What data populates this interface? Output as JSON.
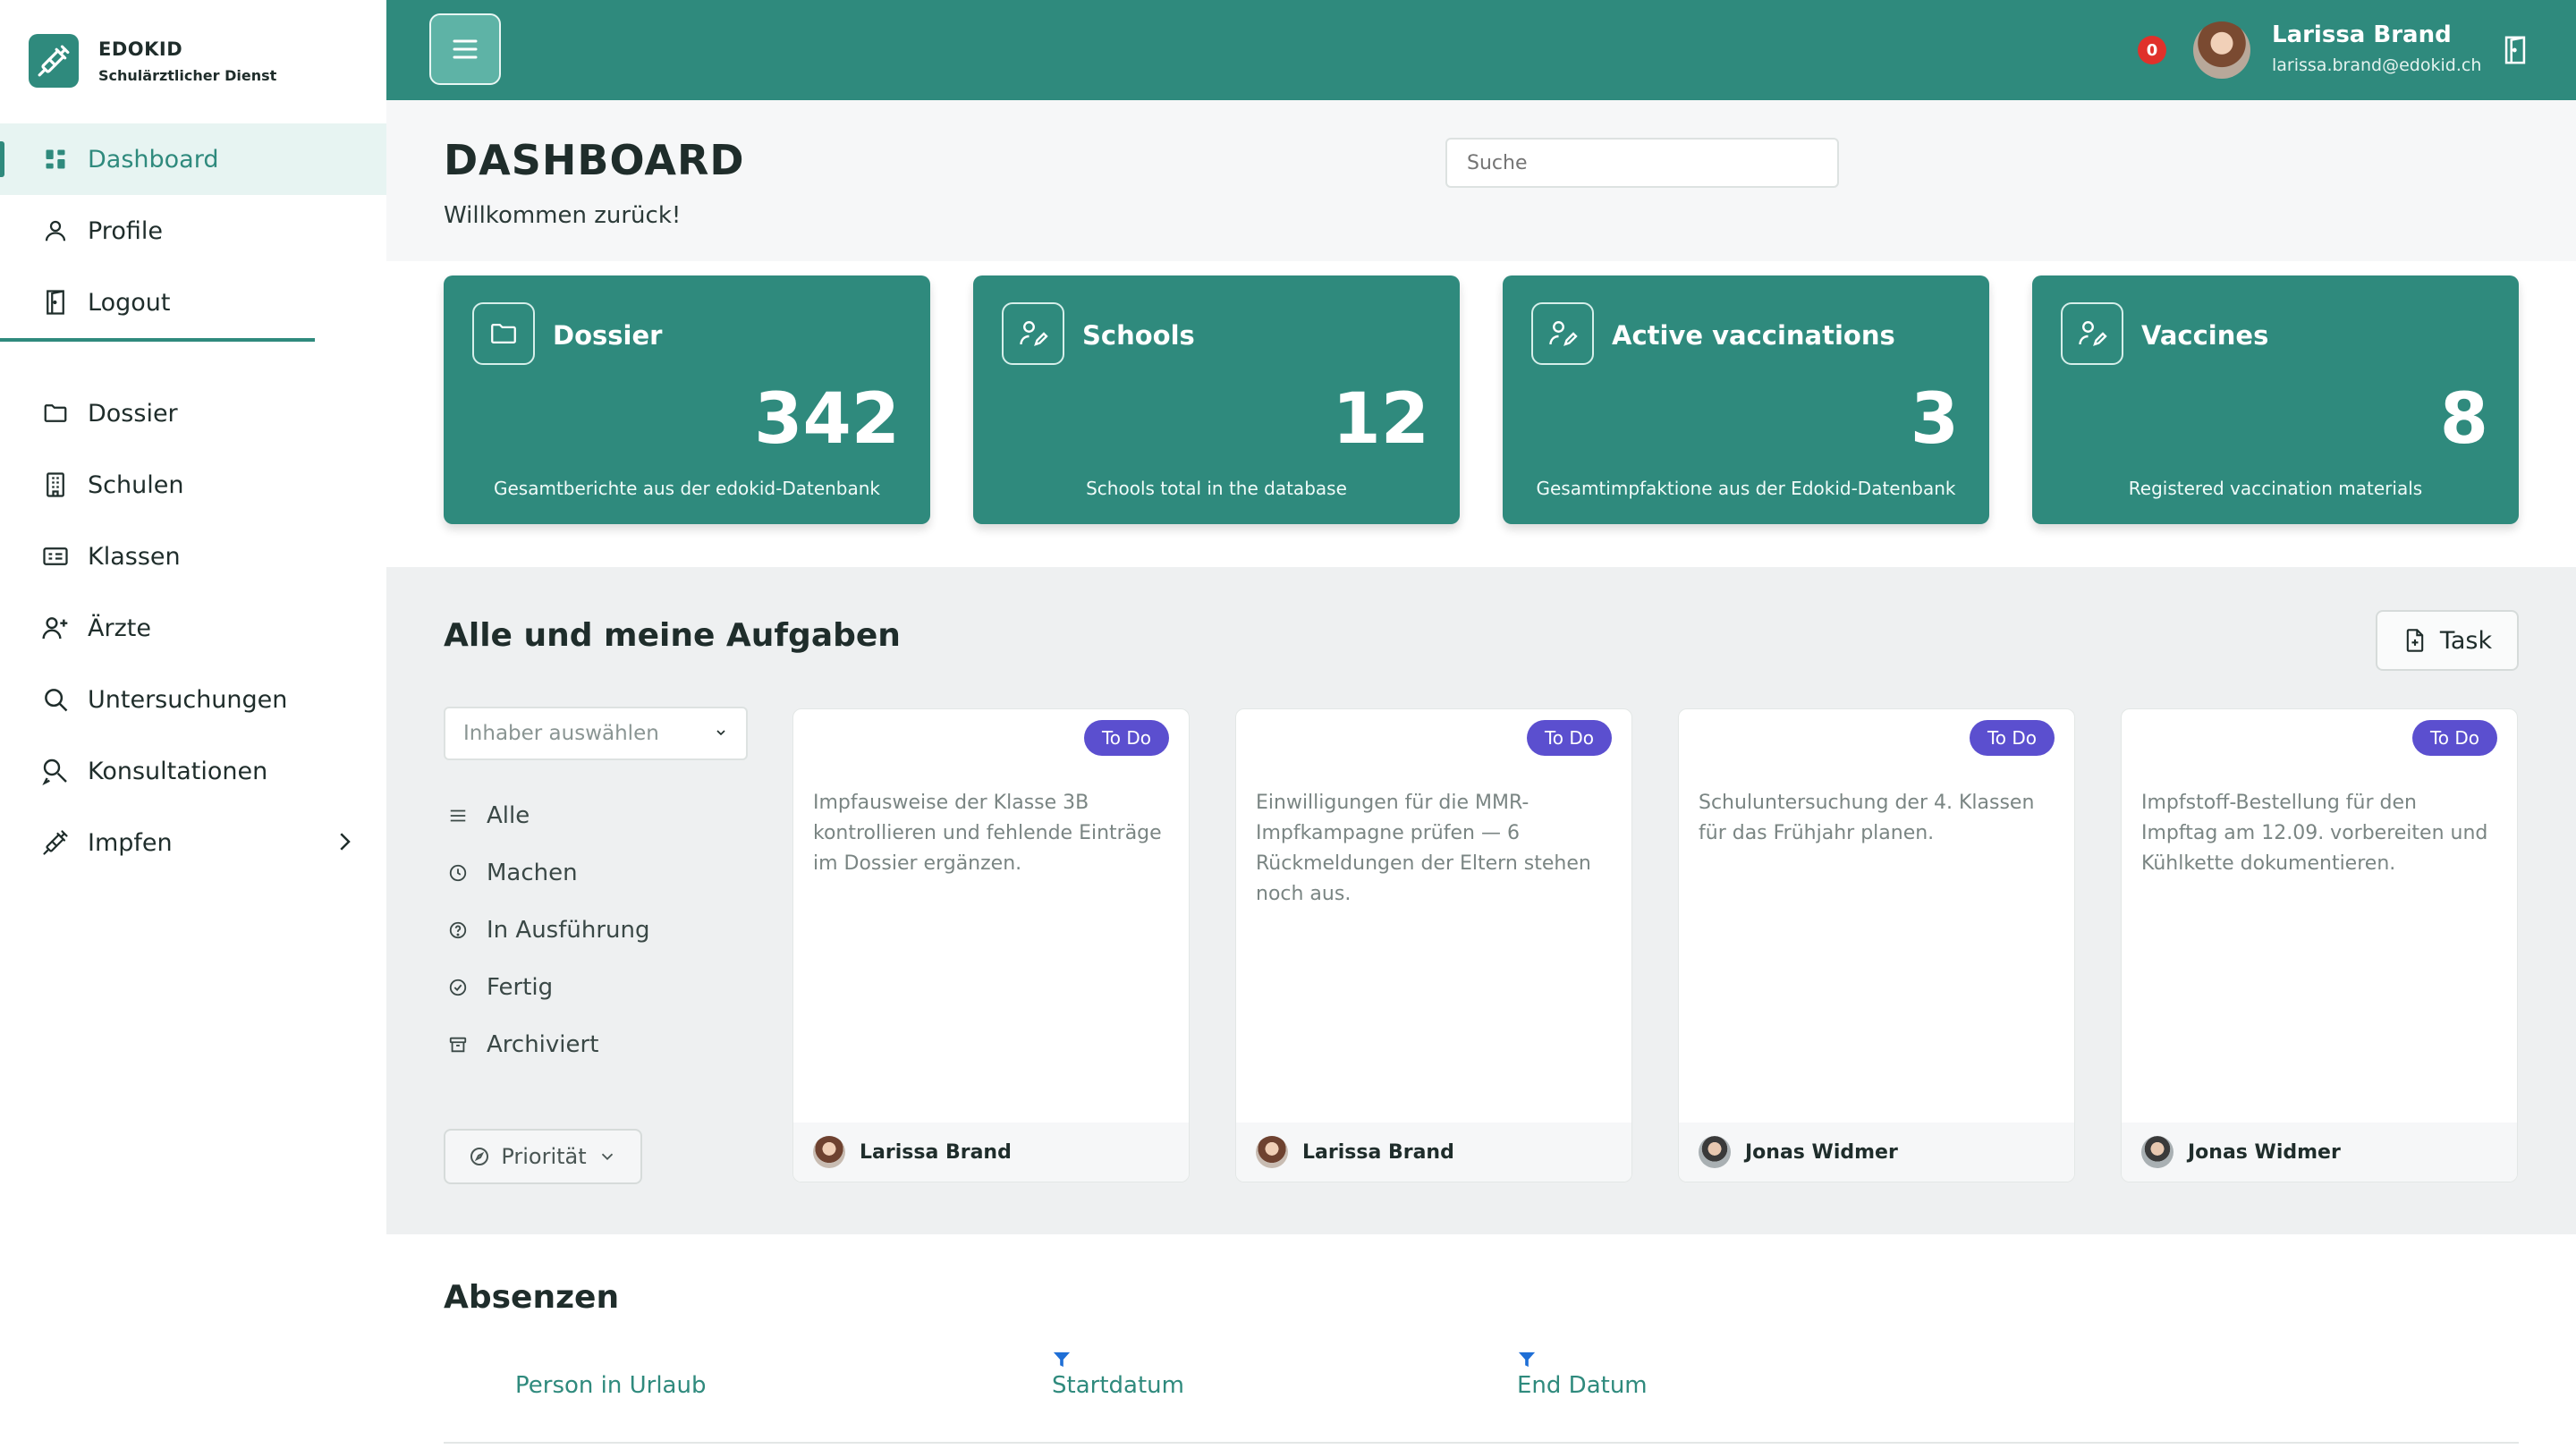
{
  "brand": {
    "name": "EDOKID",
    "subtitle": "Schulärztlicher Dienst"
  },
  "sidebar": {
    "primary": [
      {
        "label": "Dashboard",
        "icon": "dashboard-icon",
        "active": true
      },
      {
        "label": "Profile",
        "icon": "user-icon"
      },
      {
        "label": "Logout",
        "icon": "door-icon"
      }
    ],
    "secondary": [
      {
        "label": "Dossier",
        "icon": "folder-icon"
      },
      {
        "label": "Schulen",
        "icon": "building-icon"
      },
      {
        "label": "Klassen",
        "icon": "id-card-icon"
      },
      {
        "label": "Ärzte",
        "icon": "user-plus-icon"
      },
      {
        "label": "Untersuchungen",
        "icon": "search-icon"
      },
      {
        "label": "Konsultationen",
        "icon": "consultation-icon"
      },
      {
        "label": "Impfen",
        "icon": "syringe-icon",
        "has_submenu": true
      }
    ]
  },
  "topbar": {
    "notifications": "0",
    "user_name": "Larissa Brand",
    "user_email": "larissa.brand@edokid.ch",
    "accent": "#2f8a7d"
  },
  "header": {
    "title": "DASHBOARD",
    "subtitle": "Willkommen zurück!",
    "search_placeholder": "Suche"
  },
  "stats": [
    {
      "title": "Dossier",
      "value": "342",
      "desc": "Gesamtberichte aus der edokid-Datenbank",
      "icon": "folder-icon"
    },
    {
      "title": "Schools",
      "value": "12",
      "desc": "Schools total in the database",
      "icon": "user-edit-icon"
    },
    {
      "title": "Active vaccinations",
      "value": "3",
      "desc": "Gesamtimpfaktione aus der Edokid-Datenbank",
      "icon": "user-edit-icon"
    },
    {
      "title": "Vaccines",
      "value": "8",
      "desc": "Registered vaccination materials",
      "icon": "user-edit-icon"
    }
  ],
  "tasks": {
    "title": "Alle und meine Aufgaben",
    "add_button": "Task",
    "owner_placeholder": "Inhaber auswählen",
    "filters": [
      {
        "label": "Alle",
        "icon": "list-icon"
      },
      {
        "label": "Machen",
        "icon": "clock-icon"
      },
      {
        "label": "In Ausführung",
        "icon": "question-circle-icon"
      },
      {
        "label": "Fertig",
        "icon": "check-circle-icon"
      },
      {
        "label": "Archiviert",
        "icon": "archive-icon"
      }
    ],
    "priority_button": "Priorität",
    "badge_color": "#5b4fcf",
    "cards": [
      {
        "status": "To Do",
        "text": "Impfausweise der Klasse 3B kontrollieren und fehlende Einträge im Dossier ergänzen.",
        "owner": "Larissa Brand",
        "avatar": "female"
      },
      {
        "status": "To Do",
        "text": "Einwilligungen für die MMR-Impfkampagne prüfen — 6 Rückmeldungen der Eltern stehen noch aus.",
        "owner": "Larissa Brand",
        "avatar": "female"
      },
      {
        "status": "To Do",
        "text": "Schuluntersuchung der 4. Klassen für das Frühjahr planen.",
        "owner": "Jonas Widmer",
        "avatar": "male"
      },
      {
        "status": "To Do",
        "text": "Impfstoff-Bestellung für den Impftag am 12.09. vorbereiten und Kühlkette dokumentieren.",
        "owner": "Jonas Widmer",
        "avatar": "male"
      }
    ]
  },
  "absences": {
    "title": "Absenzen",
    "columns": [
      "Person in Urlaub",
      "Startdatum",
      "End Datum"
    ]
  }
}
